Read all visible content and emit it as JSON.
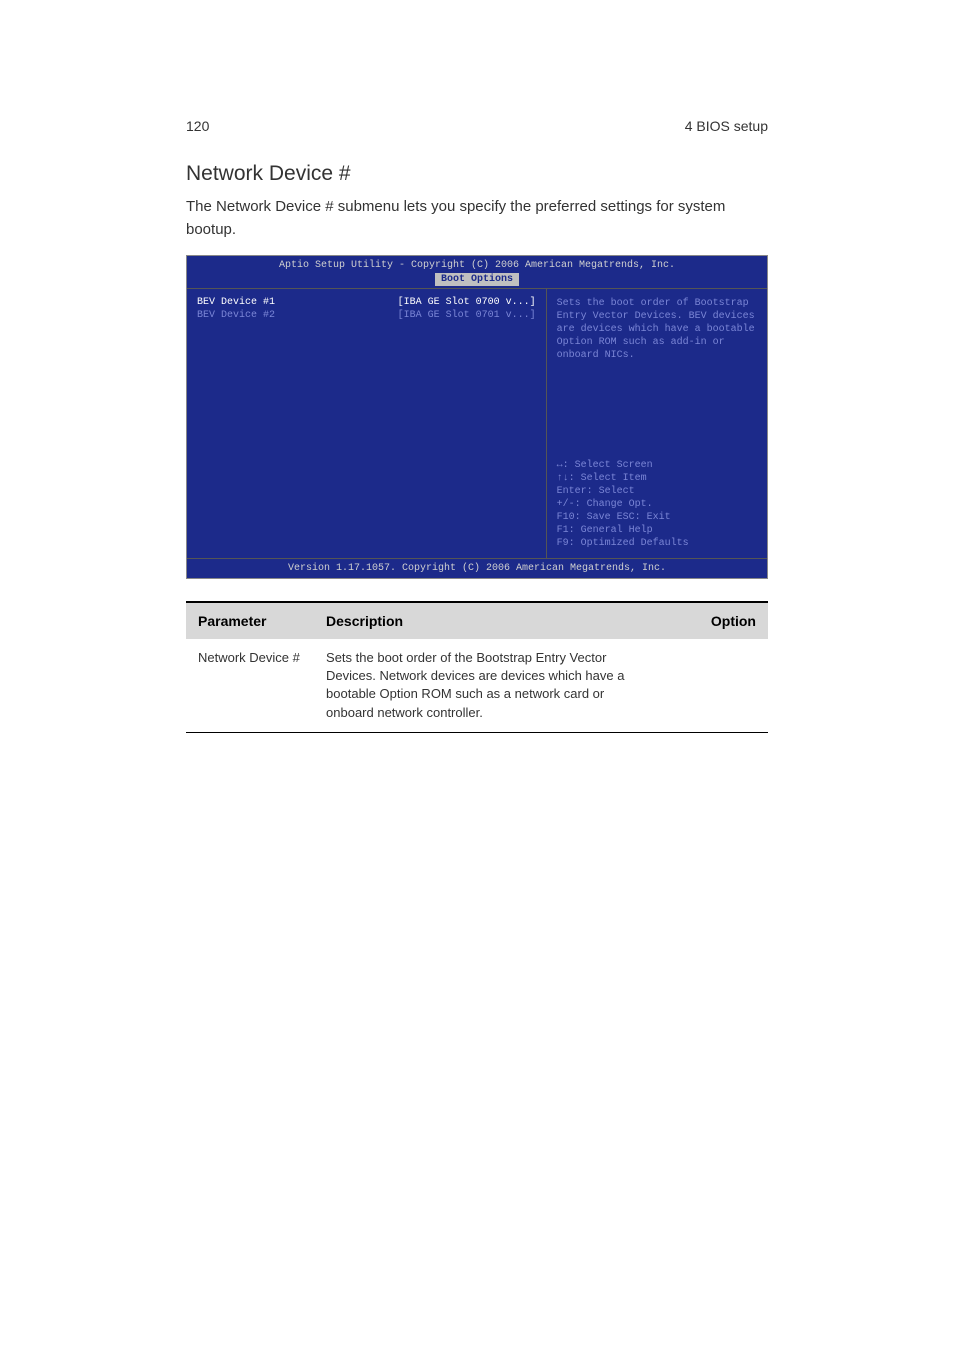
{
  "header": {
    "page_number": "120",
    "chapter": "4 BIOS setup"
  },
  "section": {
    "title": "Network Device #",
    "intro": "The Network Device # submenu lets you specify the preferred settings for system bootup."
  },
  "bios": {
    "title_bar": "Aptio Setup Utility - Copyright (C) 2006 American Megatrends, Inc.",
    "tab": "Boot Options",
    "rows": [
      {
        "label": "BEV Device #1",
        "value": "[IBA GE Slot 0700 v...]",
        "highlighted": true
      },
      {
        "label": "BEV Device #2",
        "value": "[IBA GE Slot 0701 v...]",
        "highlighted": false
      }
    ],
    "help": "Sets the boot order of Bootstrap Entry Vector Devices. BEV devices are devices which have a bootable Option ROM such as add-in or onboard NICs.",
    "keys": [
      "↔: Select Screen",
      "↑↓: Select Item",
      "Enter: Select",
      "+/-: Change Opt.",
      "F10: Save   ESC: Exit",
      "F1: General Help",
      "F9: Optimized Defaults"
    ],
    "footer": "Version 1.17.1057. Copyright (C) 2006 American Megatrends, Inc."
  },
  "table": {
    "headers": {
      "parameter": "Parameter",
      "description": "Description",
      "option": "Option"
    },
    "row": {
      "parameter": "Network Device #",
      "description": "Sets the boot order of the Bootstrap Entry Vector Devices. Network devices are devices which have a bootable Option ROM such as a network card or onboard network controller.",
      "option": ""
    }
  }
}
